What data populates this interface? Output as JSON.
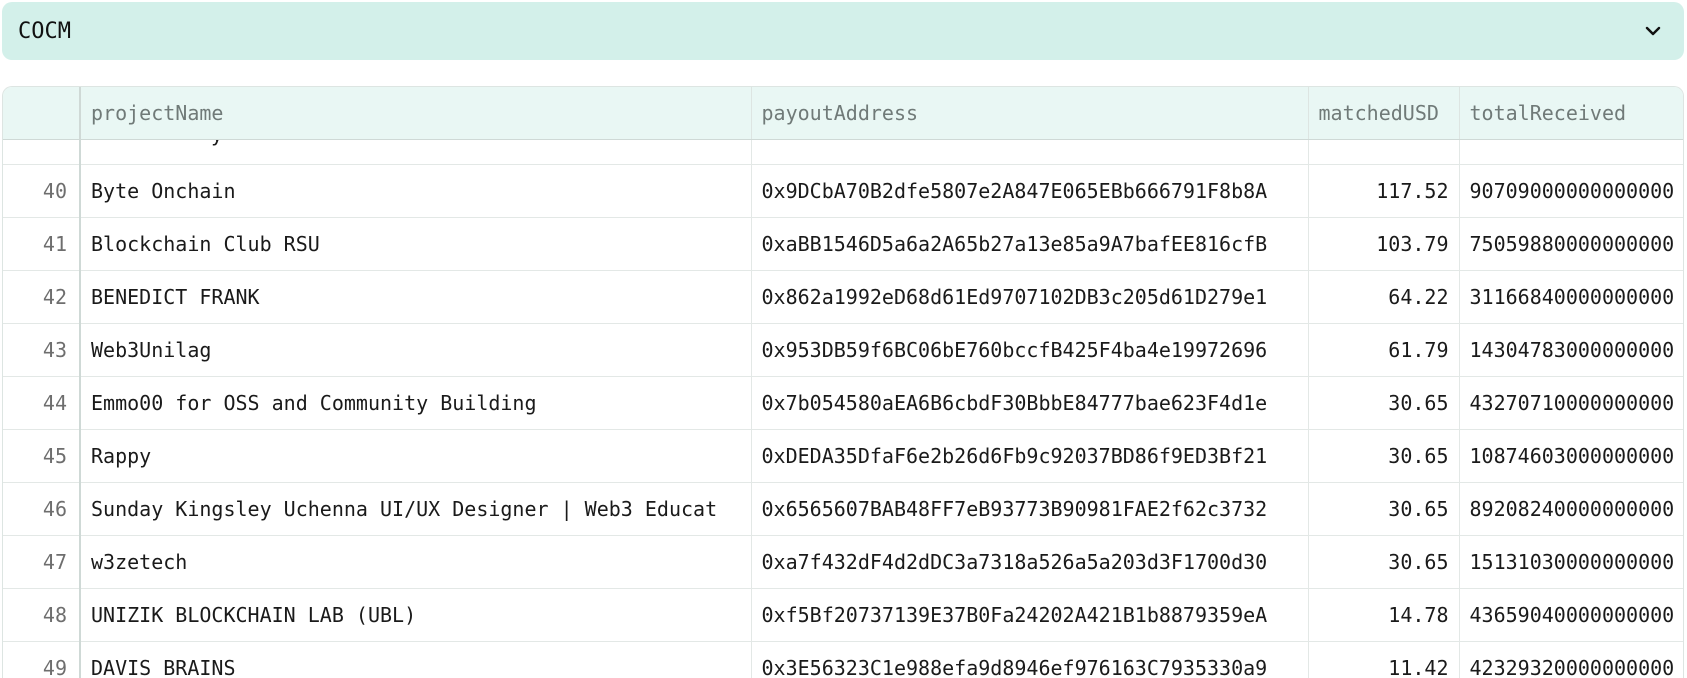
{
  "dropdown": {
    "selected": "COCM"
  },
  "table": {
    "columns": [
      "",
      "projectName",
      "payoutAddress",
      "matchedUSD",
      "totalReceived"
    ],
    "partial_row": {
      "name_fragment": "y"
    },
    "rows": [
      {
        "index": "40",
        "projectName": "Byte Onchain",
        "payoutAddress": "0x9DCbA70B2dfe5807e2A847E065EBb666791F8b8A",
        "matchedUSD": "117.52",
        "totalReceived": "90709000000000000"
      },
      {
        "index": "41",
        "projectName": "Blockchain Club RSU",
        "payoutAddress": "0xaBB1546D5a6a2A65b27a13e85a9A7bafEE816cfB",
        "matchedUSD": "103.79",
        "totalReceived": "75059880000000000"
      },
      {
        "index": "42",
        "projectName": "BENEDICT FRANK",
        "payoutAddress": "0x862a1992eD68d61Ed9707102DB3c205d61D279e1",
        "matchedUSD": "64.22",
        "totalReceived": "31166840000000000"
      },
      {
        "index": "43",
        "projectName": "Web3Unilag",
        "payoutAddress": "0x953DB59f6BC06bE760bccfB425F4ba4e19972696",
        "matchedUSD": "61.79",
        "totalReceived": "14304783000000000"
      },
      {
        "index": "44",
        "projectName": "Emmo00 for OSS and Community Building",
        "payoutAddress": "0x7b054580aEA6B6cbdF30BbbE84777bae623F4d1e",
        "matchedUSD": "30.65",
        "totalReceived": "43270710000000000"
      },
      {
        "index": "45",
        "projectName": "Rappy",
        "payoutAddress": "0xDEDA35DfaF6e2b26d6Fb9c92037BD86f9ED3Bf21",
        "matchedUSD": "30.65",
        "totalReceived": "10874603000000000"
      },
      {
        "index": "46",
        "projectName": "Sunday Kingsley Uchenna UI/UX Designer | Web3 Educat",
        "payoutAddress": "0x6565607BAB48FF7eB93773B90981FAE2f62c3732",
        "matchedUSD": "30.65",
        "totalReceived": "89208240000000000"
      },
      {
        "index": "47",
        "projectName": "w3zetech",
        "payoutAddress": "0xa7f432dF4d2dDC3a7318a526a5a203d3F1700d30",
        "matchedUSD": "30.65",
        "totalReceived": "15131030000000000"
      },
      {
        "index": "48",
        "projectName": "UNIZIK BLOCKCHAIN LAB (UBL)",
        "payoutAddress": "0xf5Bf20737139E37B0Fa24202A421B1b8879359eA",
        "matchedUSD": "14.78",
        "totalReceived": "43659040000000000"
      },
      {
        "index": "49",
        "projectName": "DAVIS BRAINS",
        "payoutAddress": "0x3E56323C1e988efa9d8946ef976163C7935330a9",
        "matchedUSD": "11.42",
        "totalReceived": "42329320000000000"
      }
    ]
  },
  "icons": {
    "dropdown_toggle": "chevron-down-icon"
  }
}
